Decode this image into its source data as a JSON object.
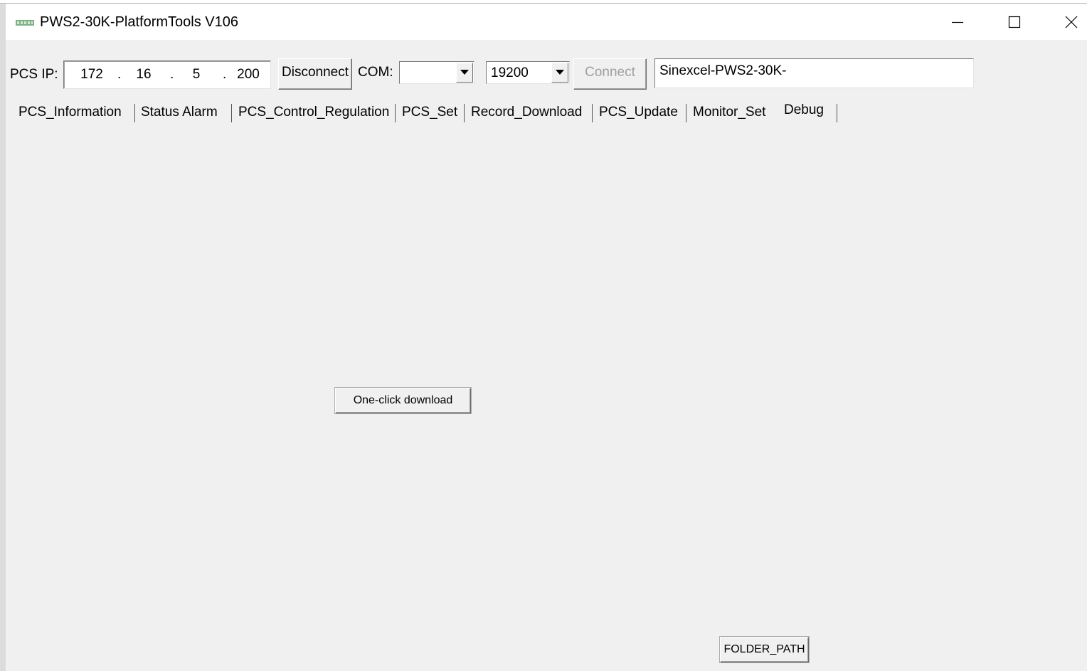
{
  "window": {
    "title": "PWS2-30K-PlatformTools V106"
  },
  "connection": {
    "pcs_ip_label": "PCS IP:",
    "ip_octets": [
      "172",
      "16",
      "5",
      "200"
    ],
    "ip_separator": ".",
    "disconnect_label": "Disconnect",
    "com_label": "COM:",
    "com_value": "",
    "baud_value": "19200",
    "connect_label": "Connect",
    "device_name": "Sinexcel-PWS2-30K-"
  },
  "tabs": [
    {
      "label": "PCS_Information"
    },
    {
      "label": "Status Alarm"
    },
    {
      "label": "PCS_Control_Regulation"
    },
    {
      "label": "PCS_Set"
    },
    {
      "label": "Record_Download"
    },
    {
      "label": "PCS_Update"
    },
    {
      "label": "Monitor_Set"
    },
    {
      "label": "Debug",
      "active": true
    }
  ],
  "debug_panel": {
    "one_click_download_label": "One-click download",
    "folder_path_label": "FOLDER_PATH"
  },
  "colors": {
    "window_bg": "#f0f0f0",
    "titlebar_bg": "#ffffff",
    "disabled_text": "#a0a0a0"
  }
}
